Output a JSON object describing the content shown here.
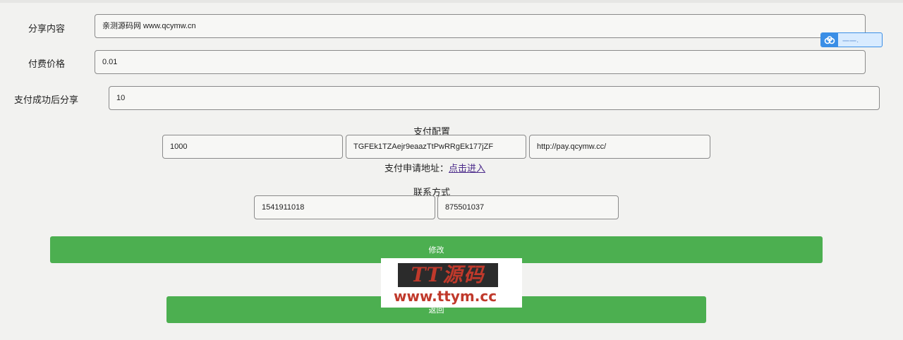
{
  "form": {
    "share_content_label": "分享内容",
    "share_content_value": "亲测源码网 www.qcymw.cn",
    "price_label": "付费价格",
    "price_value": "0.01",
    "after_pay_label": "支付成功后分享",
    "after_pay_value": "10"
  },
  "payment": {
    "title": "支付配置",
    "merchant_id": "1000",
    "merchant_key": "TGFEk1TZAejr9eaazTtPwRRgEk177jZF",
    "gateway_url": "http://pay.qcymw.cc/",
    "apply_prefix": "支付申请地址：",
    "apply_link": "点击进入"
  },
  "contact": {
    "title": "联系方式",
    "field1": "1541911018",
    "field2": "875501037"
  },
  "buttons": {
    "modify": "修改",
    "back": "返回"
  },
  "widget": {
    "icon": "baidu-cloud-icon",
    "text": "一一·"
  },
  "watermark": {
    "badge": "TT源码",
    "url": "www.ttym.cc"
  },
  "colors": {
    "button_green": "#4caf50",
    "link_purple": "#4b2a8a",
    "watermark_red": "#c0392b",
    "widget_blue": "#3a8ee6"
  }
}
